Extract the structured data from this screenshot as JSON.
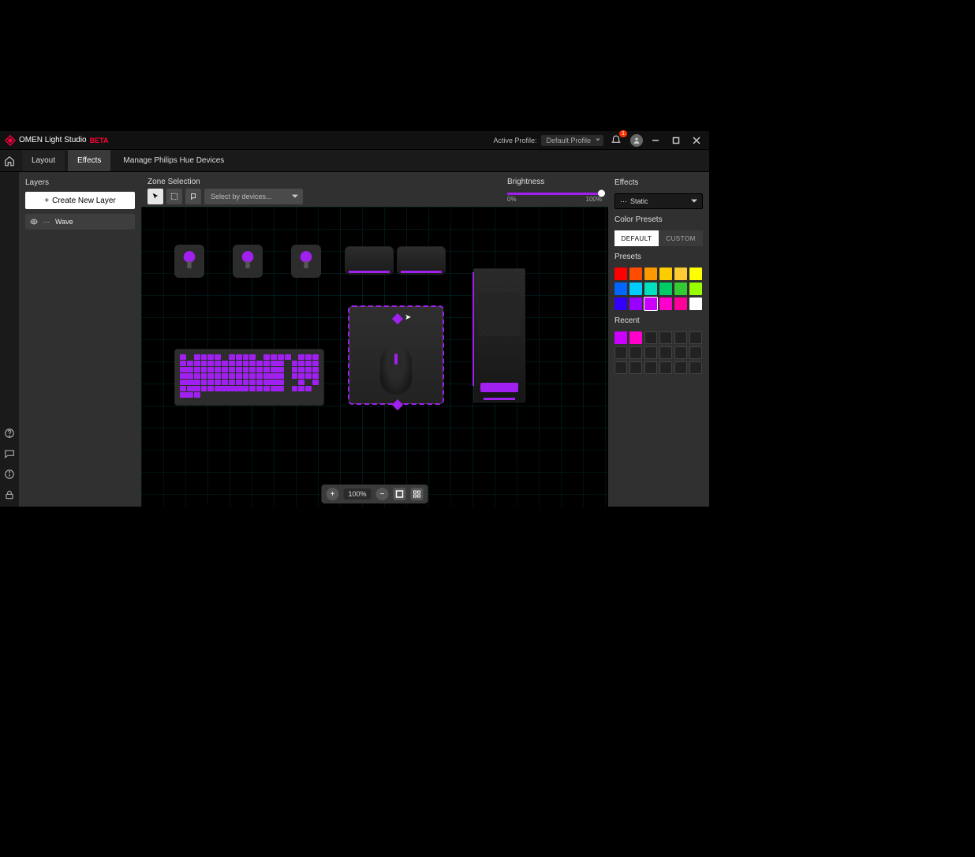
{
  "titlebar": {
    "app_name": "OMEN Light Studio",
    "beta_label": "BETA",
    "active_profile_label": "Active Profile:",
    "profile_selected": "Default Profile",
    "notification_count": "1"
  },
  "tabs": {
    "layout": "Layout",
    "effects": "Effects",
    "hue": "Manage Philips Hue Devices"
  },
  "layers": {
    "title": "Layers",
    "create_btn": "Create New Layer",
    "items": [
      {
        "name": "Wave"
      }
    ]
  },
  "center": {
    "zone_selection_label": "Zone Selection",
    "device_select_placeholder": "Select by devices...",
    "brightness_label": "Brightness",
    "brightness_min": "0%",
    "brightness_max": "100%",
    "zoom_value": "100%"
  },
  "effects": {
    "title": "Effects",
    "selected_effect": "Static",
    "color_presets_label": "Color Presets",
    "seg_default": "DEFAULT",
    "seg_custom": "CUSTOM",
    "presets_label": "Presets",
    "preset_colors": [
      "#ff0000",
      "#ff4d00",
      "#ff9900",
      "#ffcc00",
      "#ffcc33",
      "#ffff00",
      "#0066ff",
      "#00ccff",
      "#00e0c0",
      "#00cc66",
      "#33cc33",
      "#99ff00",
      "#3300ff",
      "#9900ff",
      "#cc00ff",
      "#ff00cc",
      "#ff0099",
      "#ffffff"
    ],
    "selected_preset_index": 14,
    "recent_label": "Recent",
    "recent_colors": [
      "#cc00ff",
      "#ff00cc",
      null,
      null,
      null,
      null,
      null,
      null,
      null,
      null,
      null,
      null,
      null,
      null,
      null,
      null,
      null,
      null
    ]
  }
}
